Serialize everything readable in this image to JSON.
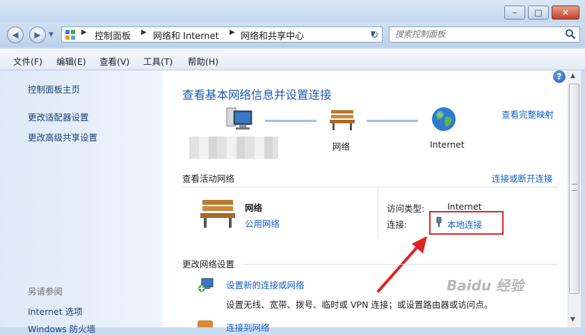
{
  "window": {
    "minimize_glyph": "–",
    "maximize_glyph": "□",
    "close_glyph": "✕"
  },
  "address": {
    "breadcrumbs": [
      "控制面板",
      "网络和 Internet",
      "网络和共享中心"
    ],
    "refresh_glyph": "↻"
  },
  "search": {
    "placeholder": "搜索控制面板"
  },
  "menu": [
    "文件(F)",
    "编辑(E)",
    "查看(V)",
    "工具(T)",
    "帮助(H)"
  ],
  "sidebar": {
    "links": [
      "控制面板主页",
      "更改适配器设置",
      "更改高级共享设置"
    ],
    "see_also": "另请参阅",
    "see_also_links": [
      "Internet 选项",
      "Windows 防火墙"
    ]
  },
  "main": {
    "title": "查看基本网络信息并设置连接",
    "full_map_link": "查看完整映射",
    "map_network_label": "网络",
    "map_internet_label": "Internet",
    "active_section": "查看活动网络",
    "connect_link": "连接或断开连接",
    "network_name": "网络",
    "network_type": "公用网络",
    "access_type_label": "访问类型:",
    "access_type_value": "Internet",
    "connection_label": "连接:",
    "connection_value": "本地连接",
    "change_section": "更改网络设置",
    "setup_link": "设置新的连接或网络",
    "setup_desc": "设置无线、宽带、拨号、临时或 VPN 连接；或设置路由器或访问点。",
    "second_link": "连接到网络",
    "help_glyph": "?"
  },
  "watermark": "Baidu 经验",
  "colors": {
    "link": "#1561c4",
    "highlight": "#e02222",
    "heading": "#1d5cb0"
  }
}
